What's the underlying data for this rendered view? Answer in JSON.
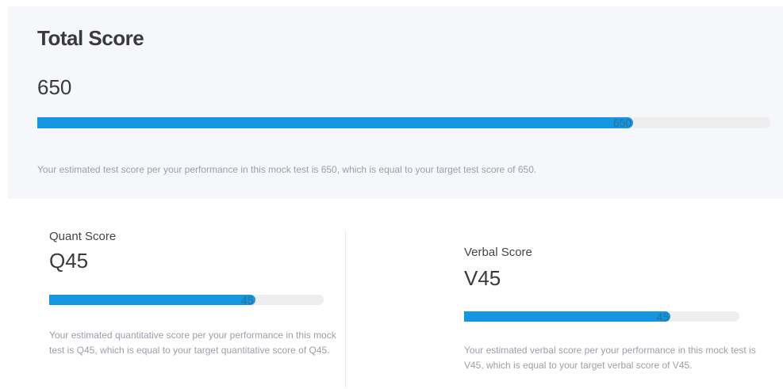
{
  "total": {
    "title": "Total Score",
    "value": "650",
    "bar_label": "650",
    "progress_fraction": 0.813,
    "description": "Your estimated test score per your performance in this mock test is 650, which is equal to your target test score of 650."
  },
  "quant": {
    "label": "Quant Score",
    "value": "Q45",
    "bar_label": "45",
    "progress_fraction": 0.75,
    "description": "Your estimated quantitative score per your performance in this mock test is Q45, which is equal to your target quantitative score of Q45."
  },
  "verbal": {
    "label": "Verbal Score",
    "value": "V45",
    "bar_label": "45",
    "progress_fraction": 0.75,
    "description": "Your estimated verbal score per your performance in this mock test is V45, which is equal to your target verbal score of V45."
  },
  "colors": {
    "bar_fill": "#1596e0",
    "bar_track": "#eeeeee",
    "card_background": "#f5f7fb"
  }
}
